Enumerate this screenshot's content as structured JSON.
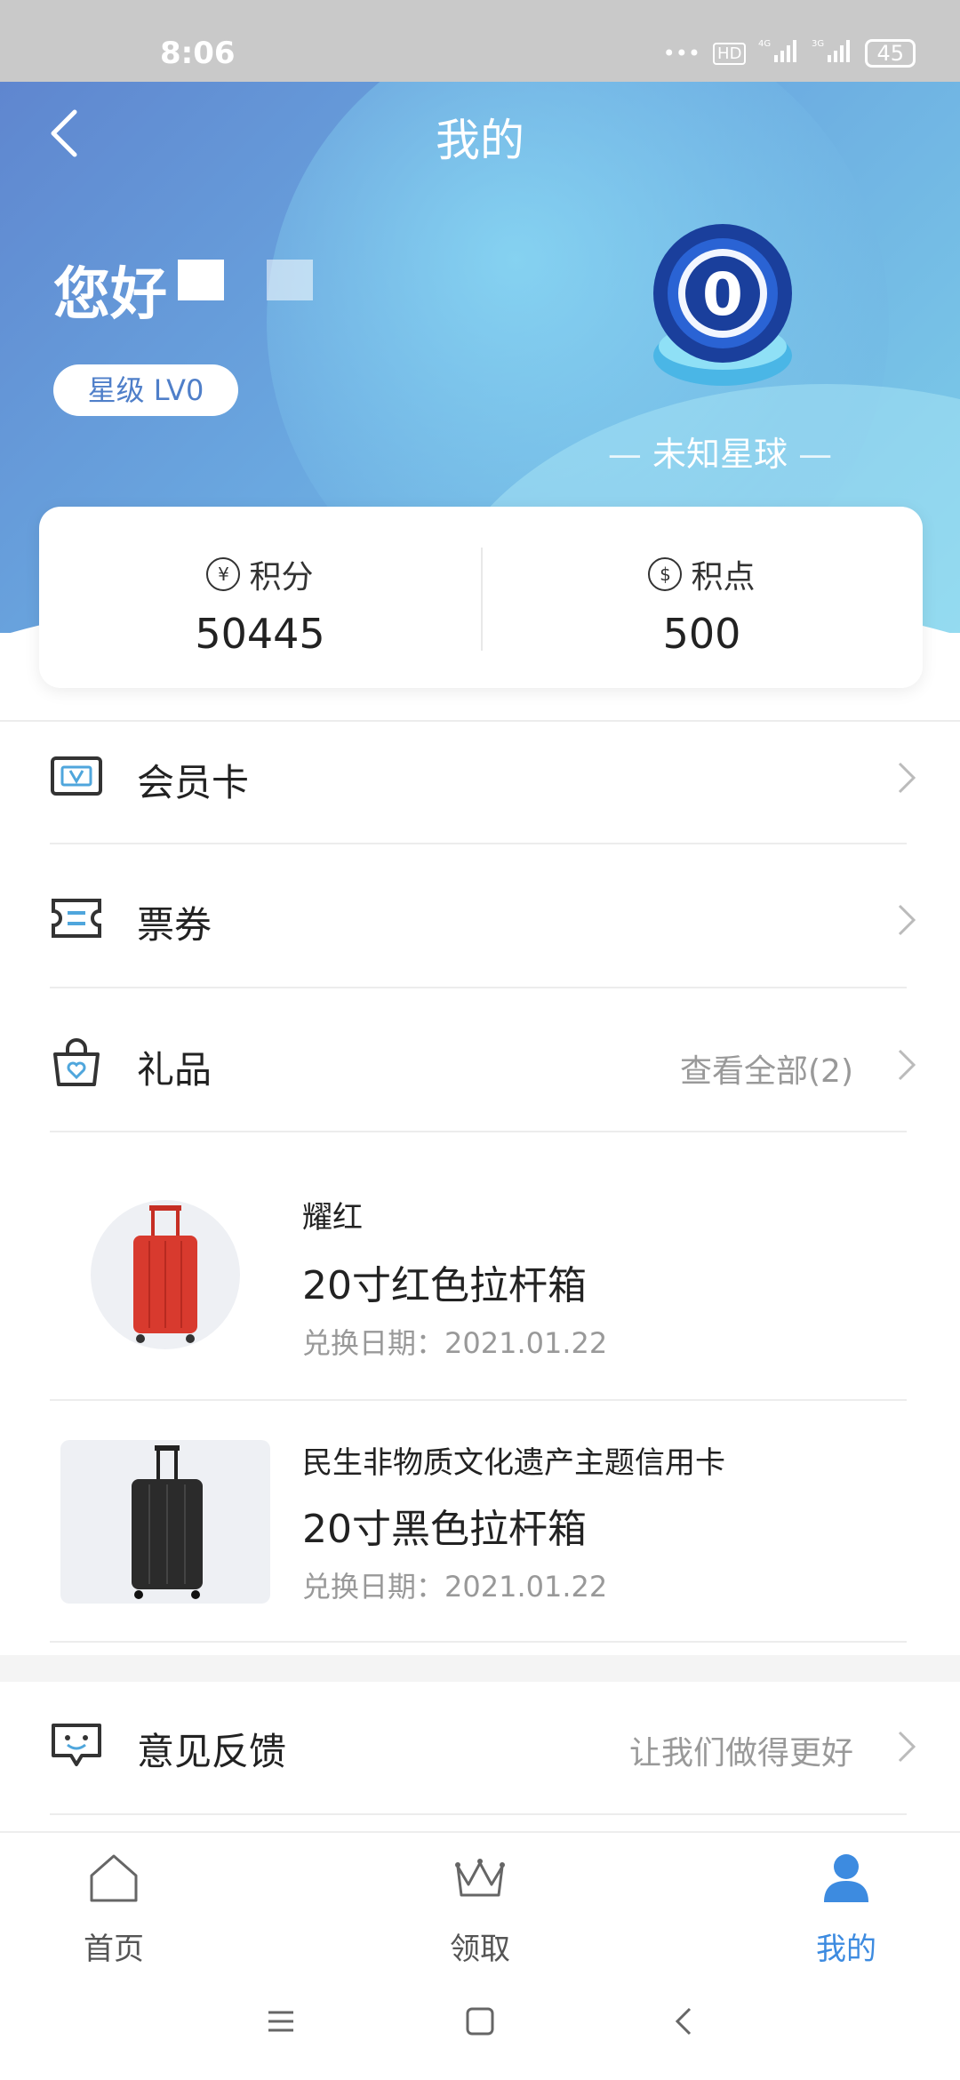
{
  "status_bar": {
    "time": "8:06",
    "icons": [
      "more-dots-icon",
      "hd-icon",
      "signal-4g-icon",
      "signal-3g-icon"
    ],
    "battery": "45"
  },
  "header": {
    "title": "我的"
  },
  "profile": {
    "greeting": "您好",
    "level": "星级 LV0",
    "planet": "未知星球",
    "planet_level_glyph": "0"
  },
  "stats": [
    {
      "label": "积分",
      "value": "50445",
      "icon": "yen-icon",
      "glyph": "¥"
    },
    {
      "label": "积点",
      "value": "500",
      "icon": "money-bag-icon",
      "glyph": "$"
    }
  ],
  "menu": {
    "member_card": "会员卡",
    "tickets": "票券",
    "gifts": "礼品",
    "gifts_extra": "查看全部(2)"
  },
  "gifts": [
    {
      "brand": "耀红",
      "name": "20寸红色拉杆箱",
      "date": "兑换日期：2021.01.22",
      "color": "#d83a2e"
    },
    {
      "brand": "民生非物质文化遗产主题信用卡",
      "name": "20寸黑色拉杆箱",
      "date": "兑换日期：2021.01.22",
      "color": "#2b2b2b"
    }
  ],
  "feedback": {
    "label": "意见反馈",
    "extra": "让我们做得更好"
  },
  "tabs": [
    {
      "label": "首页",
      "icon": "home-icon"
    },
    {
      "label": "领取",
      "icon": "crown-icon"
    },
    {
      "label": "我的",
      "icon": "person-icon",
      "active": true
    }
  ],
  "colors": {
    "accent": "#3d8be0",
    "hero_start": "#5f86cf",
    "hero_end": "#7ed0ea"
  }
}
